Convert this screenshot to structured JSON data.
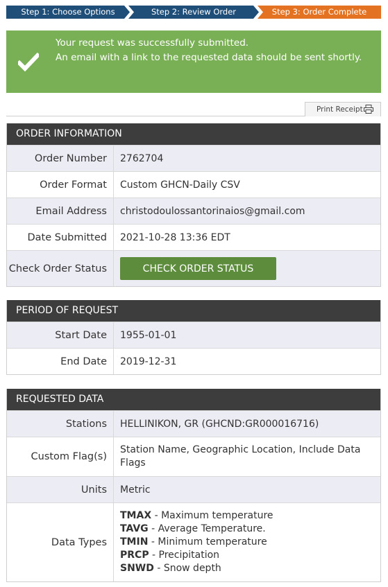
{
  "steps": [
    {
      "label": "Step 1: Choose Options"
    },
    {
      "label": "Step 2: Review Order"
    },
    {
      "label": "Step 3: Order Complete"
    }
  ],
  "banner": {
    "line1": "Your request was successfully submitted.",
    "line2": "An email with a link to the requested data should be sent shortly.",
    "icon": "checkmark-icon"
  },
  "print_receipt": {
    "label": "Print Receipt",
    "icon": "printer-icon"
  },
  "order_information": {
    "title": "ORDER INFORMATION",
    "order_number_label": "Order Number",
    "order_number": "2762704",
    "order_format_label": "Order Format",
    "order_format": "Custom GHCN-Daily CSV",
    "email_label": "Email Address",
    "email": "christodoulossantorinaios@gmail.com",
    "date_submitted_label": "Date Submitted",
    "date_submitted": "2021-10-28 13:36 EDT",
    "check_status_label": "Check Order Status",
    "check_status_button": "CHECK ORDER STATUS"
  },
  "period_of_request": {
    "title": "PERIOD OF REQUEST",
    "start_label": "Start Date",
    "start": "1955-01-01",
    "end_label": "End Date",
    "end": "2019-12-31"
  },
  "requested_data": {
    "title": "REQUESTED DATA",
    "stations_label": "Stations",
    "stations": "HELLINIKON, GR (GHCND:GR000016716)",
    "flags_label": "Custom Flag(s)",
    "flags_line1": "Station Name, Geographic Location, Include Data",
    "flags_line2": "Flags",
    "units_label": "Units",
    "units": "Metric",
    "data_types_label": "Data Types",
    "data_types": [
      {
        "code": "TMAX",
        "desc": " - Maximum temperature"
      },
      {
        "code": "TAVG",
        "desc": " - Average Temperature."
      },
      {
        "code": "TMIN",
        "desc": " - Minimum temperature"
      },
      {
        "code": "PRCP",
        "desc": " - Precipitation"
      },
      {
        "code": "SNWD",
        "desc": " - Snow depth"
      }
    ]
  },
  "colors": {
    "step_active": "#e37222",
    "step_done": "#1f4e79",
    "banner_green": "#7ab055",
    "button_green": "#5d8d3c",
    "panel_header": "#3d3d3d",
    "row_shade": "#ececf4"
  }
}
